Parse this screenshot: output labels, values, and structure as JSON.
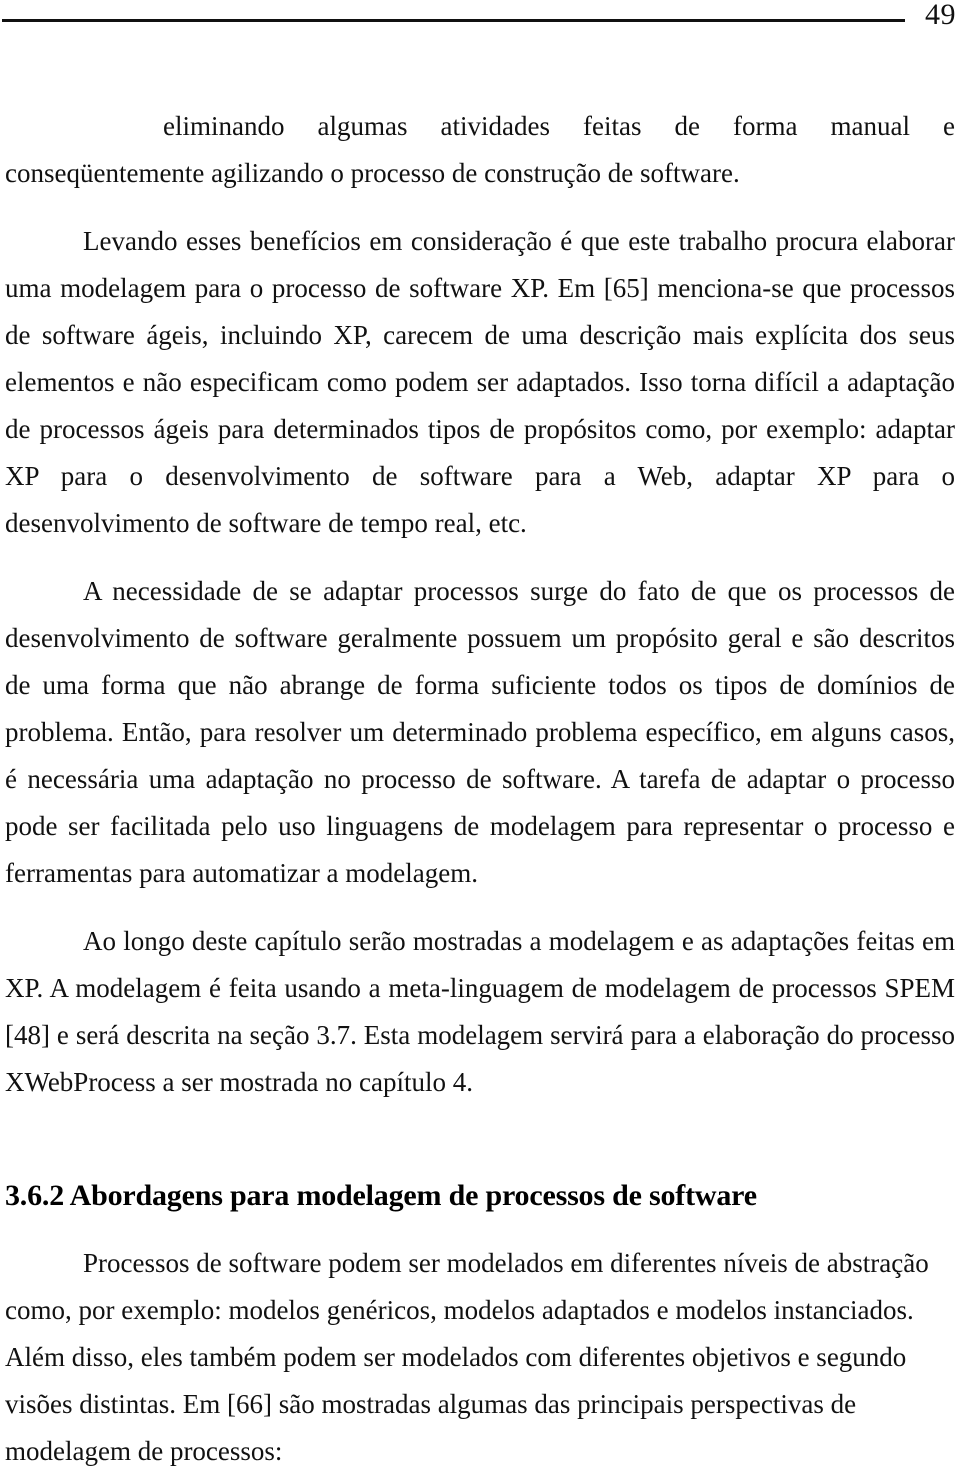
{
  "document": {
    "language": "pt-BR",
    "page_number": "49",
    "colors": {
      "text": "#111111",
      "rule": "#111111",
      "background": "#ffffff"
    }
  },
  "header": {
    "page_number": "49",
    "rule": "horizontal-rule"
  },
  "body": {
    "paragraphs": [
      {
        "id": "p-continued",
        "style": "continued-from-previous-page",
        "text": "eliminando algumas atividades feitas de forma manual e conseqüentemente agilizando o processo de construção de software."
      },
      {
        "id": "p-levando",
        "style": "indented",
        "text": "Levando esses benefícios em consideração é que este trabalho procura elaborar uma modelagem para o processo de software XP. Em [65] menciona-se que processos de software ágeis, incluindo XP, carecem de uma descrição mais explícita dos seus elementos e não especificam como podem ser adaptados. Isso torna difícil a adaptação de processos ágeis para determinados tipos de propósitos como, por exemplo: adaptar XP para o desenvolvimento de software para a Web, adaptar XP para o desenvolvimento de software de tempo real, etc."
      },
      {
        "id": "p-necessidade",
        "style": "indented",
        "text": "A necessidade de se adaptar processos surge do fato de que os processos de desenvolvimento de software geralmente possuem um propósito geral e são descritos de uma forma que não abrange de forma suficiente todos os tipos de domínios de problema. Então, para resolver um determinado problema específico, em alguns casos, é necessária uma adaptação no processo de software. A tarefa de adaptar o processo pode ser facilitada pelo uso linguagens de modelagem para representar o processo e ferramentas para automatizar a modelagem."
      },
      {
        "id": "p-aolongo",
        "style": "indented",
        "text": "Ao longo deste capítulo serão mostradas a modelagem e as adaptações feitas em XP. A modelagem é feita usando a meta-linguagem de modelagem de processos SPEM [48] e será descrita na seção 3.7. Esta modelagem servirá para a elaboração do processo XWebProcess a ser mostrada no capítulo 4."
      }
    ],
    "heading": {
      "number": "3.6.2",
      "title": "Abordagens para modelagem de processos de software",
      "full_text": "3.6.2 Abordagens para modelagem de processos de software",
      "level": 2
    },
    "paragraphs_after_heading": [
      {
        "id": "p-processos",
        "style": "indented",
        "text": "Processos de software podem ser modelados em diferentes níveis de abstração como, por exemplo: modelos genéricos, modelos adaptados e modelos instanciados. Além disso, eles também podem ser modelados com diferentes objetivos e segundo visões distintas. Em [66] são mostradas algumas das principais perspectivas de modelagem de processos:"
      }
    ]
  }
}
